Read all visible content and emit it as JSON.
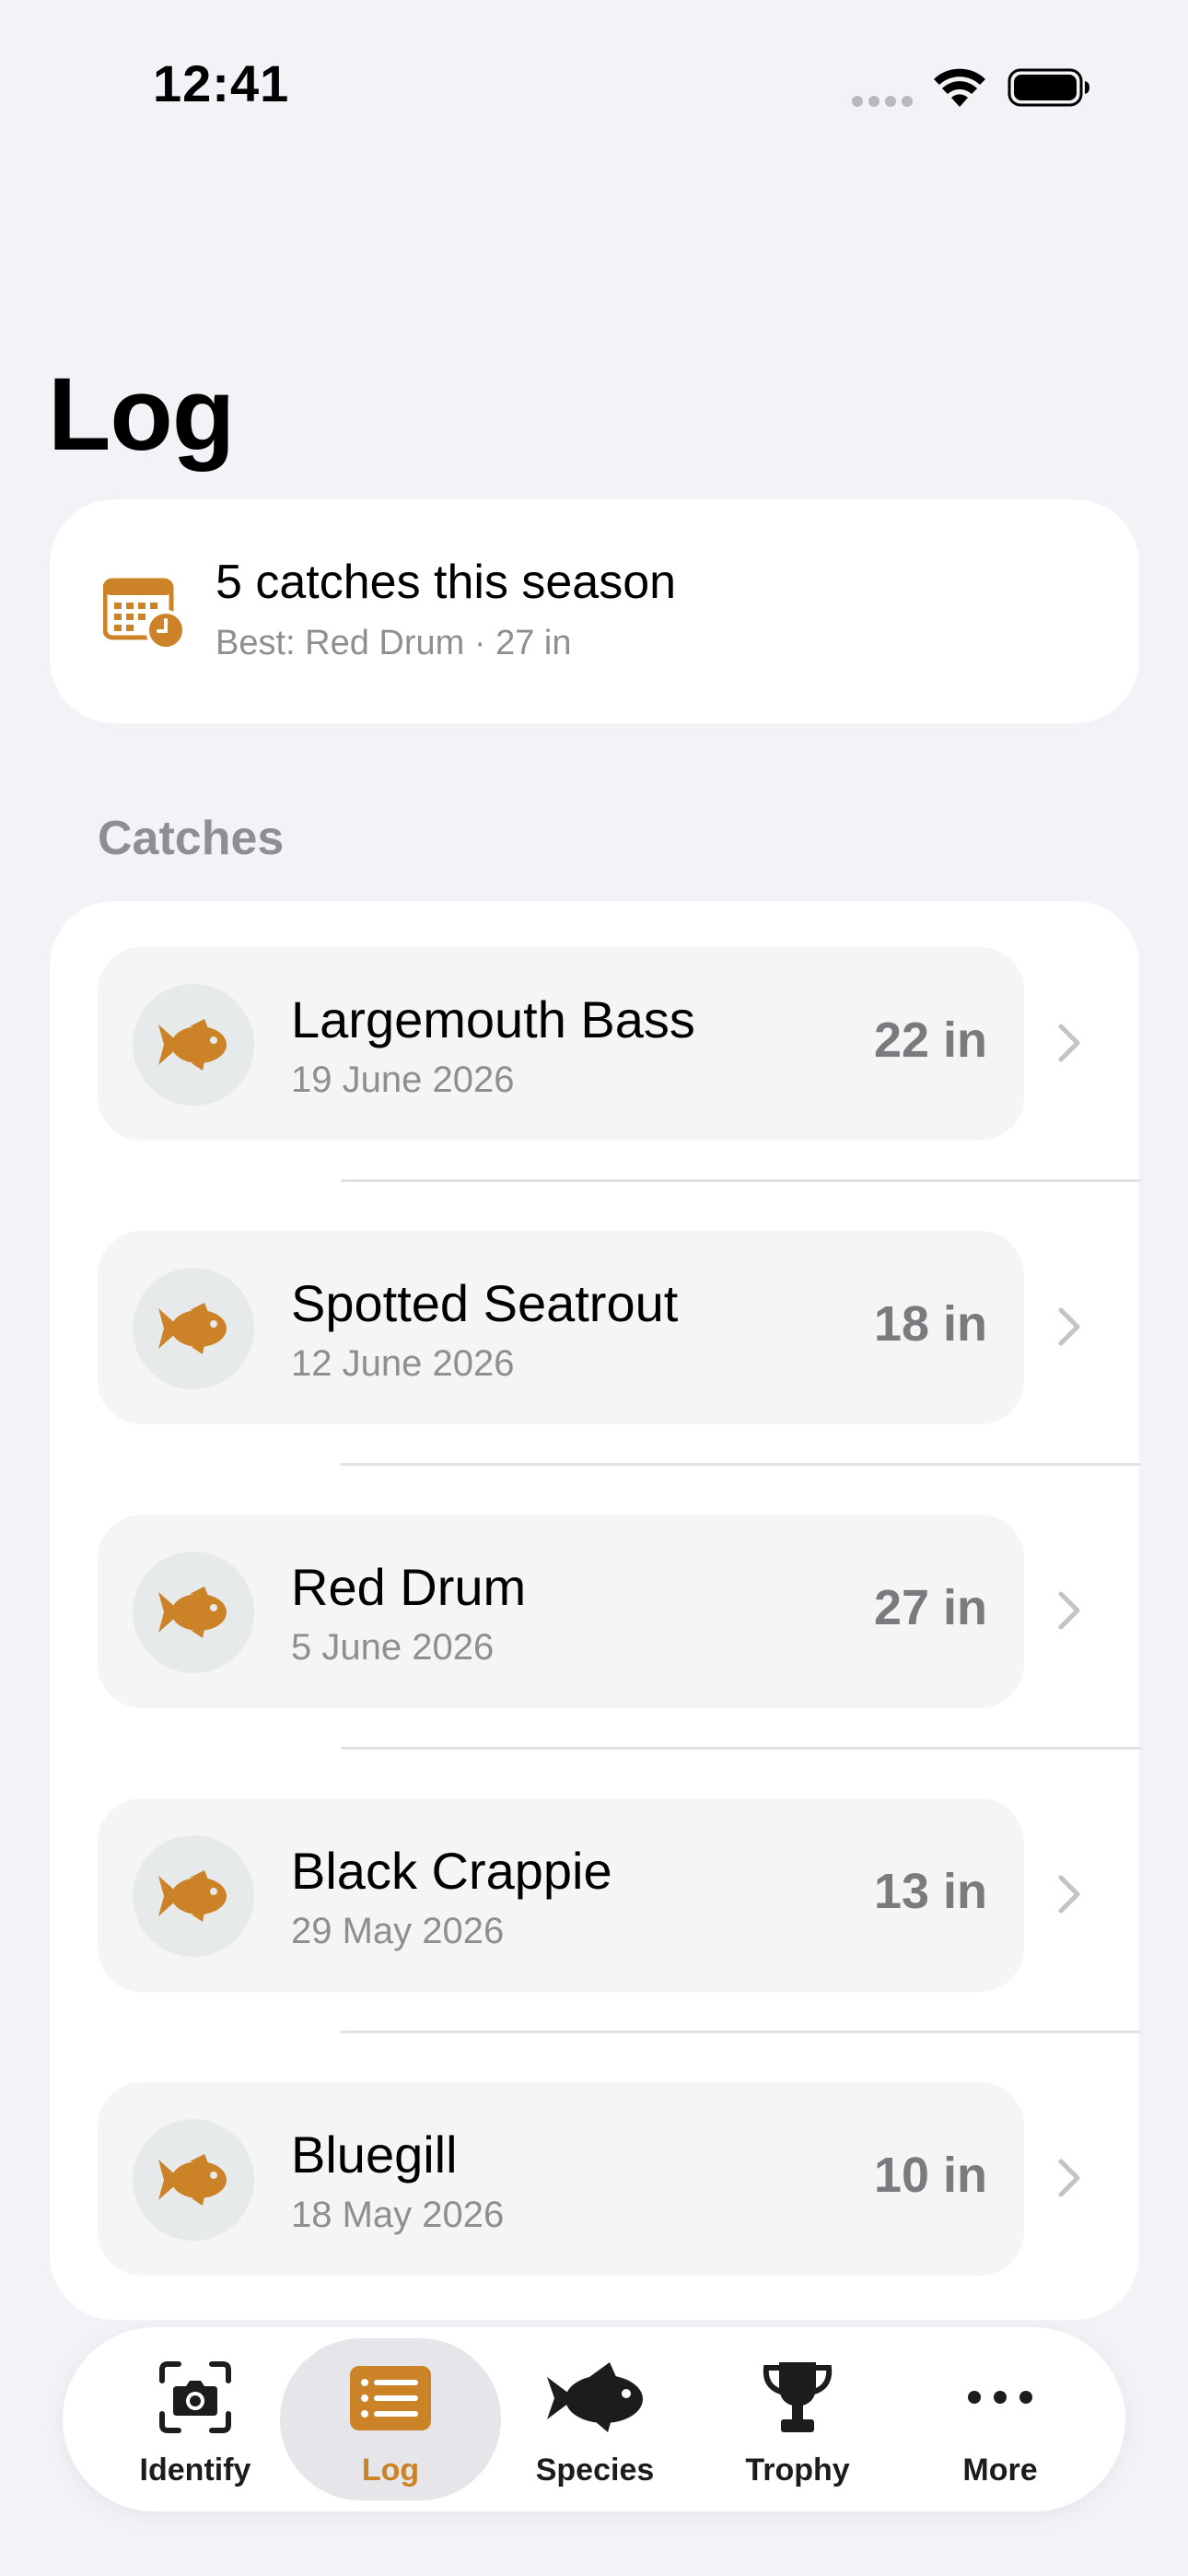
{
  "status_bar": {
    "time": "12:41"
  },
  "page": {
    "title": "Log"
  },
  "summary": {
    "title": "5 catches this season",
    "subtitle": "Best: Red Drum · 27 in",
    "icon": "calendar-clock-icon"
  },
  "catches": {
    "section_label": "Catches",
    "items": [
      {
        "name": "Largemouth Bass",
        "date": "19 June 2026",
        "size": "22 in",
        "icon": "fish-icon"
      },
      {
        "name": "Spotted Seatrout",
        "date": "12 June 2026",
        "size": "18 in",
        "icon": "fish-icon"
      },
      {
        "name": "Red Drum",
        "date": "5 June 2026",
        "size": "27 in",
        "icon": "fish-icon"
      },
      {
        "name": "Black Crappie",
        "date": "29 May 2026",
        "size": "13 in",
        "icon": "fish-icon"
      },
      {
        "name": "Bluegill",
        "date": "18 May 2026",
        "size": "10 in",
        "icon": "fish-icon"
      }
    ]
  },
  "tab_bar": {
    "tabs": [
      {
        "label": "Identify",
        "icon": "camera-viewfinder-icon",
        "active": false
      },
      {
        "label": "Log",
        "icon": "list-icon",
        "active": true
      },
      {
        "label": "Species",
        "icon": "fish-icon",
        "active": false
      },
      {
        "label": "Trophy",
        "icon": "trophy-icon",
        "active": false
      },
      {
        "label": "More",
        "icon": "ellipsis-icon",
        "active": false
      }
    ]
  },
  "colors": {
    "accent": "#cc8226",
    "background": "#f2f2f7",
    "card": "#ffffff",
    "secondary_text": "#8e8e93"
  }
}
